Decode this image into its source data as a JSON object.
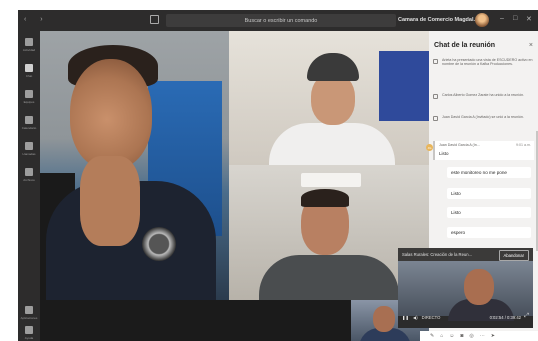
{
  "titlebar": {
    "search_placeholder": "Buscar o escribir un comando",
    "org_name": "Camara de Comercio Magdal...",
    "win_minimize": "–",
    "win_maximize": "□",
    "win_close": "✕"
  },
  "rail": {
    "items": [
      {
        "label": "Actividad",
        "icon": "bell-icon"
      },
      {
        "label": "Chat",
        "icon": "chat-icon"
      },
      {
        "label": "Equipos",
        "icon": "teams-icon"
      },
      {
        "label": "Calendario",
        "icon": "calendar-icon"
      },
      {
        "label": "Llamadas",
        "icon": "phone-icon"
      },
      {
        "label": "Archivos",
        "icon": "file-icon"
      },
      {
        "label": "Aplicaciones",
        "icon": "apps-icon"
      },
      {
        "label": "Ayuda",
        "icon": "help-icon"
      }
    ]
  },
  "chat": {
    "title": "Chat de la reunión",
    "close": "×",
    "system_messages": [
      "Arieta ha presentado una vista de ESCUDERO activo en nombre de la reunión a Kafka Producciones.",
      "Carlos Alberto Gomez Zarate ha unido a la reunión.",
      "Juan David Garcia A (Invitado) se unió a la reunión."
    ],
    "reply": {
      "avatar": "JG",
      "name": "Juan David Garcia A (In...",
      "time": "9:01 a.m.",
      "text": "Listo"
    },
    "messages": [
      "este monitoreo no me pone",
      "Listo",
      "Listo",
      "espero"
    ]
  },
  "pip": {
    "title": "Salas Rurales: Creación de la Reun...",
    "button": "Abandonar",
    "live_label": "DIRECTO",
    "time": "0:02:54 / 0:39:42"
  }
}
